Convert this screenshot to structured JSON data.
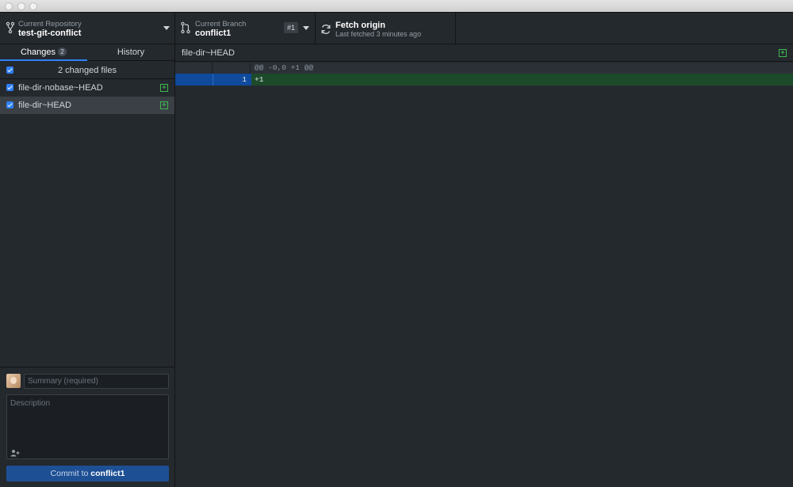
{
  "toolbar": {
    "repository": {
      "label": "Current Repository",
      "name": "test-git-conflict",
      "icon": "repo-icon"
    },
    "branch": {
      "label": "Current Branch",
      "name": "conflict1",
      "pr_badge": "#1",
      "icon": "branch-icon"
    },
    "fetch": {
      "title": "Fetch origin",
      "status": "Last fetched 3 minutes ago",
      "icon": "sync-icon"
    }
  },
  "sidebar": {
    "tabs": [
      {
        "label": "Changes",
        "count": "2",
        "active": true
      },
      {
        "label": "History",
        "active": false
      }
    ],
    "changes_header": "2 changed files",
    "files": [
      {
        "name": "file-dir-nobase~HEAD",
        "status": "added",
        "checked": true,
        "selected": false
      },
      {
        "name": "file-dir~HEAD",
        "status": "added",
        "checked": true,
        "selected": true
      }
    ],
    "commit": {
      "summary_placeholder": "Summary (required)",
      "description_placeholder": "Description",
      "button_prefix": "Commit to",
      "button_branch": "conflict1"
    }
  },
  "diff": {
    "file_title": "file-dir~HEAD",
    "hunk_header": "@@ -0,0 +1 @@",
    "lines": [
      {
        "new_line_no": "1",
        "text": "+1",
        "type": "added"
      }
    ]
  },
  "colors": {
    "background": "#24292e",
    "accent_blue": "#2f81f7",
    "added_green": "#3fb950",
    "added_row": "#1d4a2a",
    "commit_button": "#1d4f94"
  }
}
